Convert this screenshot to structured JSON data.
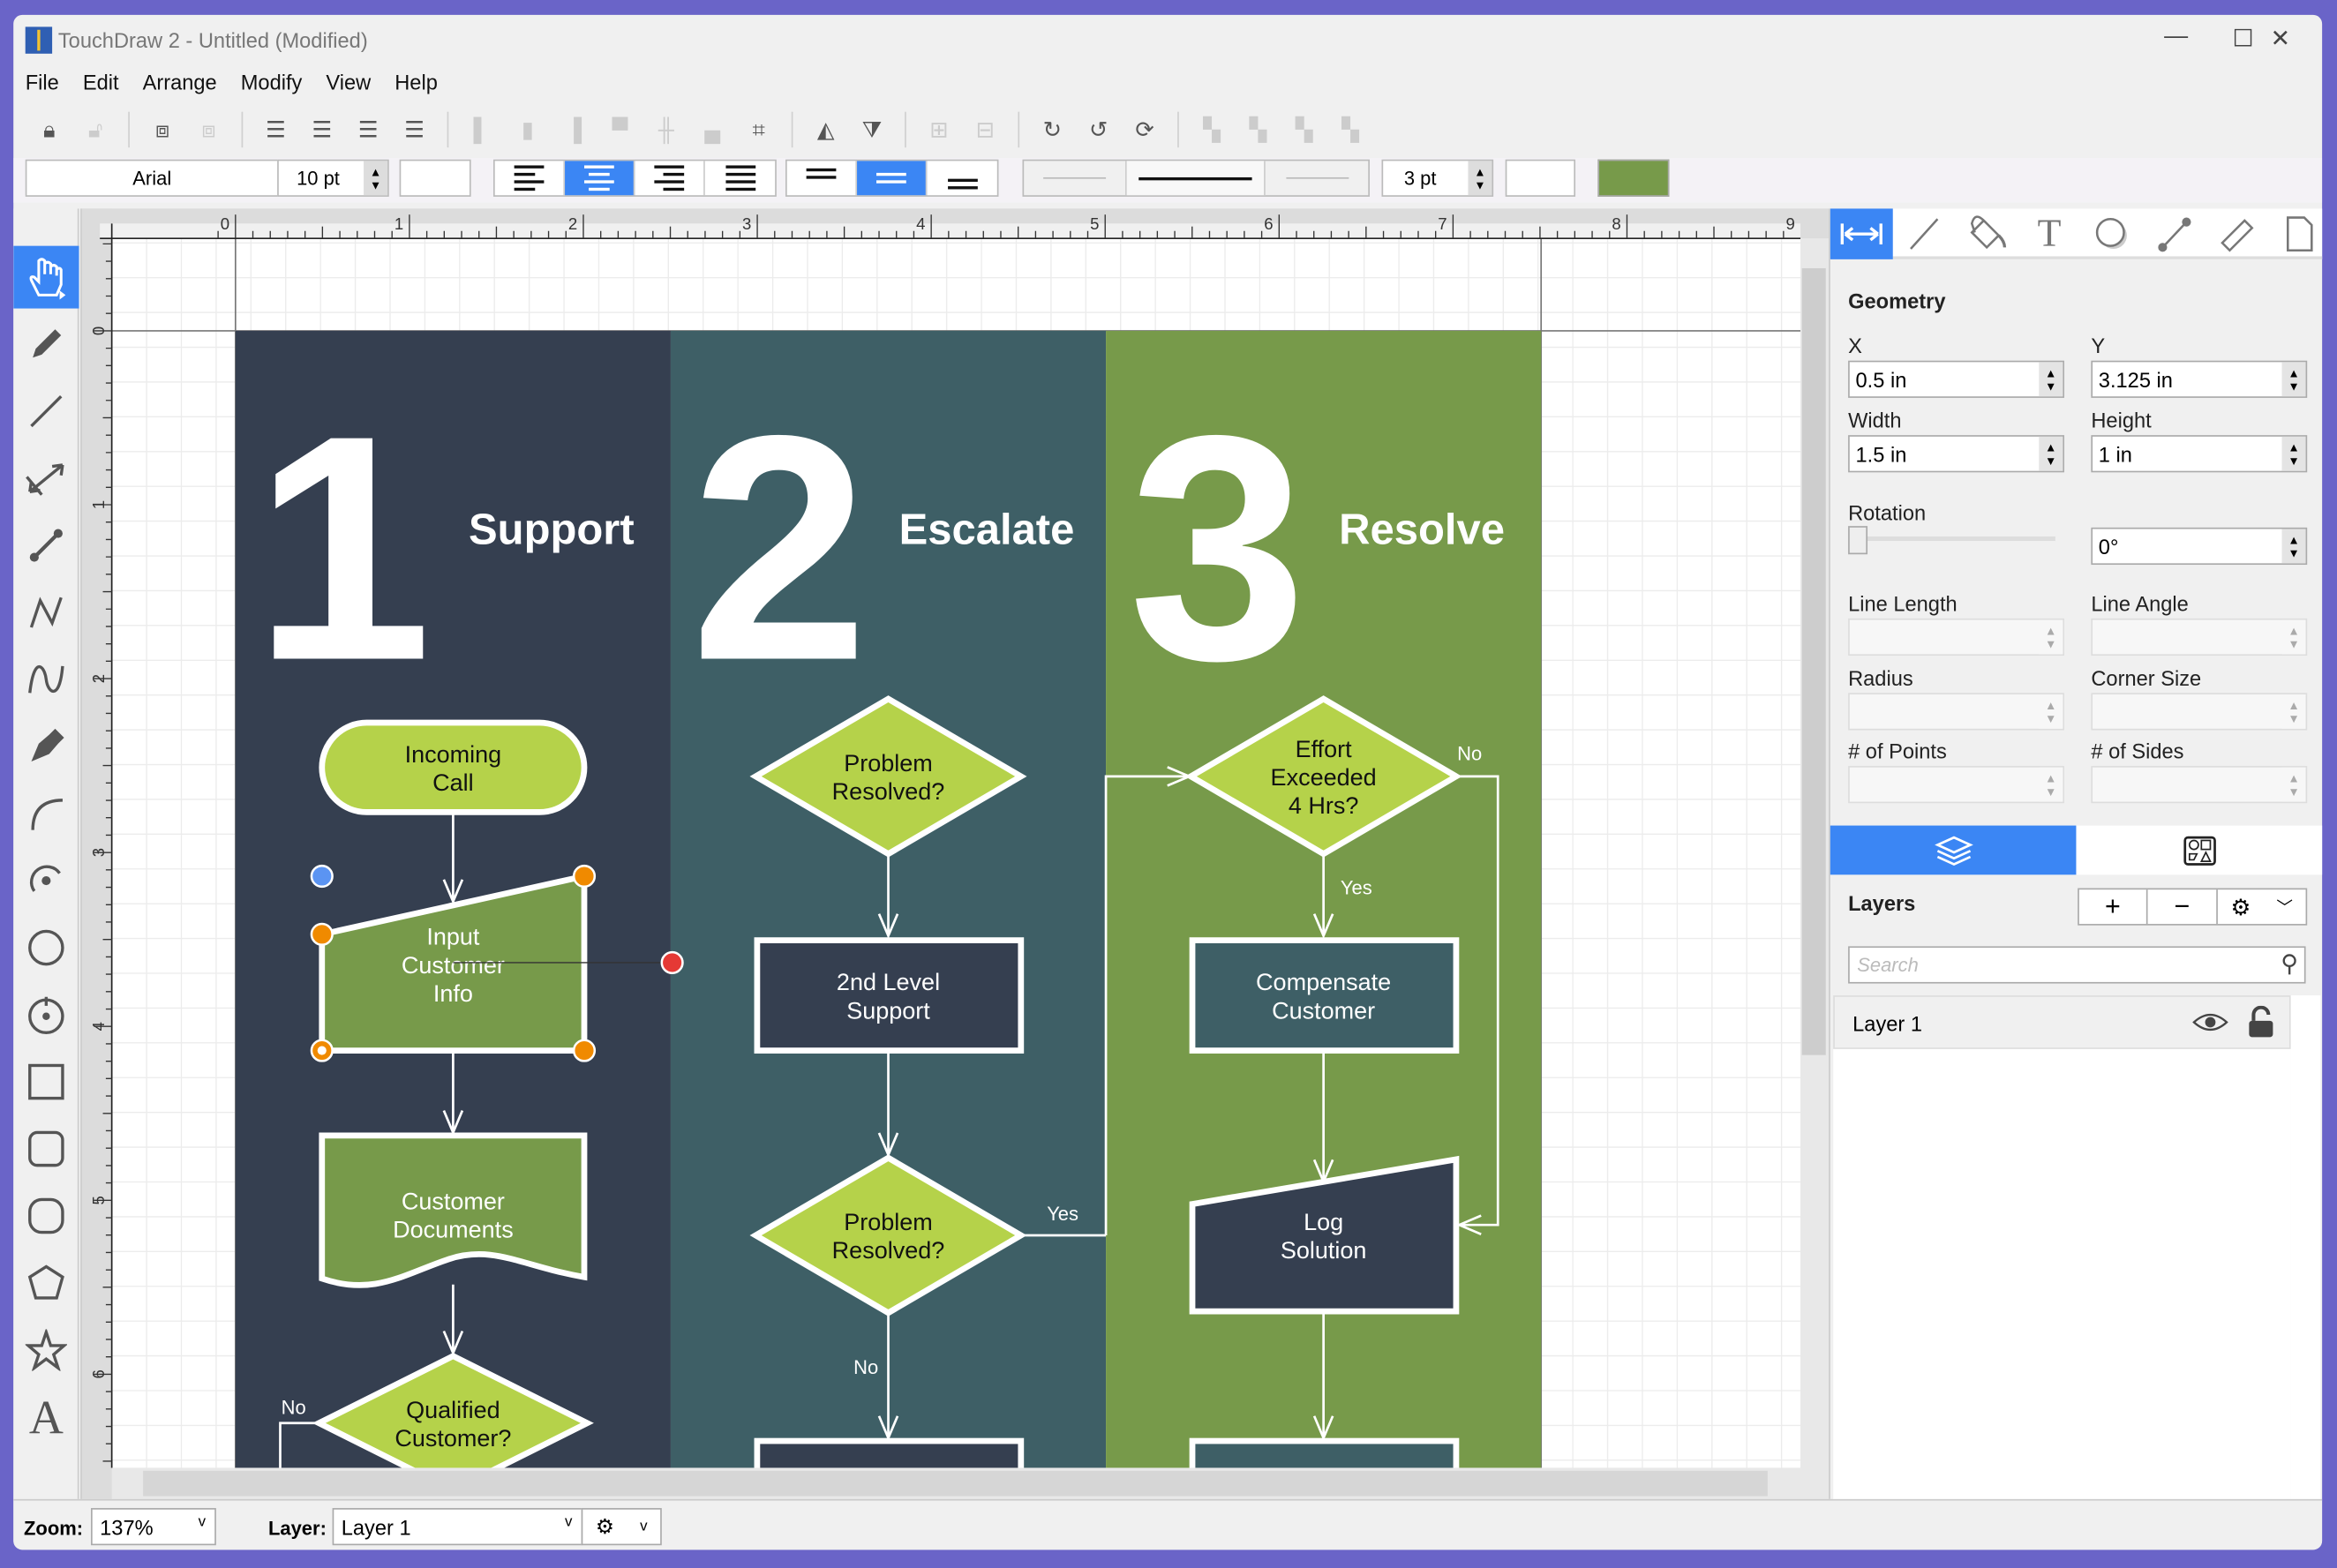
{
  "window": {
    "title": "TouchDraw 2 - Untitled (Modified)",
    "minimize": "—",
    "maximize": "☐",
    "close": "✕"
  },
  "menu": [
    "File",
    "Edit",
    "Arrange",
    "Modify",
    "View",
    "Help"
  ],
  "format_bar": {
    "font": "Arial",
    "font_size": "10 pt",
    "line_width": "3 pt",
    "fill_color": "#779a4a",
    "text_align_selected": "center",
    "vertical_align_selected": "middle"
  },
  "ruler": {
    "h_labels": [
      "0",
      "1",
      "2",
      "3",
      "4",
      "5",
      "6",
      "7",
      "8",
      "9"
    ],
    "v_labels": [
      "0",
      "1",
      "2",
      "3",
      "4",
      "5",
      "6"
    ]
  },
  "diagram": {
    "lanes": [
      {
        "number": "1",
        "title": "Support",
        "color": "#353f50"
      },
      {
        "number": "2",
        "title": "Escalate",
        "color": "#3e5f66"
      },
      {
        "number": "3",
        "title": "Resolve",
        "color": "#779a4a"
      }
    ],
    "shapes": {
      "incoming_call": [
        "Incoming",
        "Call"
      ],
      "input_customer_info": [
        "Input",
        "Customer",
        "Info"
      ],
      "customer_documents": [
        "Customer",
        "Documents"
      ],
      "qualified_customer": [
        "Qualified",
        "Customer?"
      ],
      "problem_resolved_1": [
        "Problem",
        "Resolved?"
      ],
      "second_level_support": [
        "2nd Level",
        "Support"
      ],
      "problem_resolved_2": [
        "Problem",
        "Resolved?"
      ],
      "effort_exceeded": [
        "Effort",
        "Exceeded",
        "4 Hrs?"
      ],
      "compensate_customer": [
        "Compensate",
        "Customer"
      ],
      "log_solution": [
        "Log",
        "Solution"
      ]
    },
    "labels": {
      "no_qualified": "No",
      "yes_resolved2": "Yes",
      "no_resolved2": "No",
      "no_effort": "No",
      "yes_effort": "Yes"
    },
    "colors": {
      "lime": "#b5d24a",
      "green": "#779a4a",
      "navy": "#353f50",
      "teal": "#3e5f66"
    }
  },
  "panel": {
    "geometry_title": "Geometry",
    "x_label": "X",
    "x_value": "0.5 in",
    "y_label": "Y",
    "y_value": "3.125 in",
    "width_label": "Width",
    "width_value": "1.5 in",
    "height_label": "Height",
    "height_value": "1 in",
    "rotation_label": "Rotation",
    "rotation_value": "0°",
    "rotation_fraction": 0,
    "line_length_label": "Line Length",
    "line_angle_label": "Line Angle",
    "radius_label": "Radius",
    "corner_size_label": "Corner Size",
    "points_label": "# of Points",
    "sides_label": "# of Sides",
    "layers_title": "Layers",
    "search_placeholder": "Search",
    "layers": [
      {
        "name": "Layer 1",
        "visible": true,
        "locked": true
      }
    ]
  },
  "status": {
    "zoom_label": "Zoom:",
    "zoom_value": "137%",
    "layer_label": "Layer:",
    "layer_value": "Layer 1"
  }
}
